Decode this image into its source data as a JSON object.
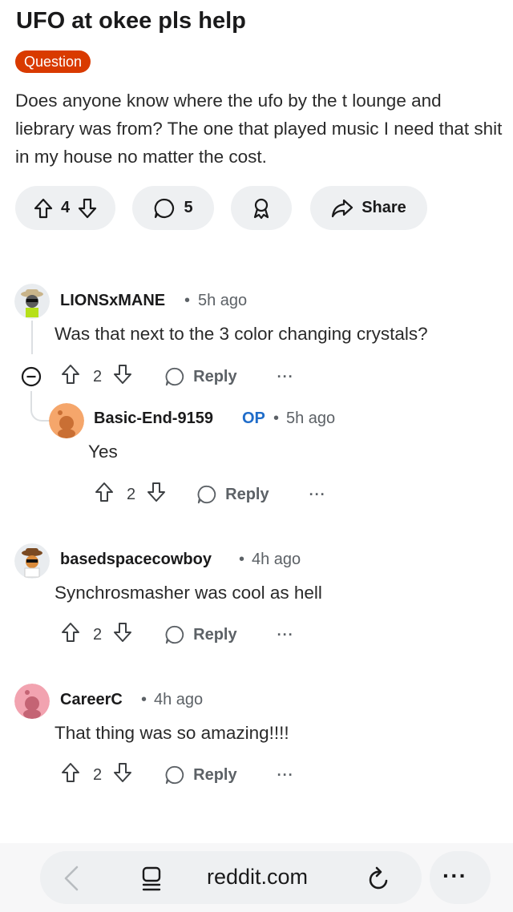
{
  "post": {
    "title": "UFO at okee pls help",
    "flair": "Question",
    "body": "Does anyone know where the ufo by the t lounge and liebrary was from? The one that played music I need that shit in my house no matter the cost.",
    "votes": "4",
    "comments": "5",
    "share_label": "Share"
  },
  "comments": [
    {
      "author": "LIONSxMANE",
      "time": "5h ago",
      "text": "Was that next to the 3 color changing crystals?",
      "votes": "2",
      "reply_label": "Reply",
      "more": "···"
    },
    {
      "author": "Basic-End-9159",
      "op": "OP",
      "time": "5h ago",
      "text": "Yes",
      "votes": "2",
      "reply_label": "Reply",
      "more": "···"
    },
    {
      "author": "basedspacecowboy",
      "time": "4h ago",
      "text": "Synchrosmasher was cool as hell",
      "votes": "2",
      "reply_label": "Reply",
      "more": "···"
    },
    {
      "author": "CareerC",
      "time": "4h ago",
      "text": "That thing was so amazing!!!!",
      "votes": "2",
      "reply_label": "Reply",
      "more": "···"
    }
  ],
  "browser": {
    "url": "reddit.com",
    "more": "···"
  },
  "separator": "•",
  "colors": {
    "flair": "#d93a00",
    "op": "#1f6cc9",
    "pill_bg": "#eef0f2"
  }
}
